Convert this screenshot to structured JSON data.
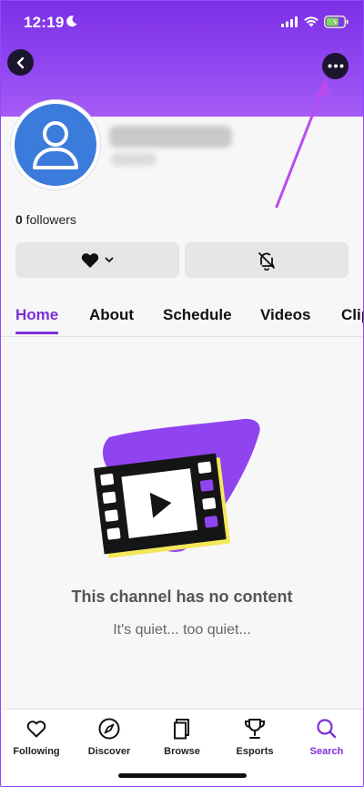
{
  "status_bar": {
    "time": "12:19"
  },
  "profile": {
    "followers_count": "0",
    "followers_label": " followers"
  },
  "tabs": [
    {
      "label": "Home",
      "active": true
    },
    {
      "label": "About",
      "active": false
    },
    {
      "label": "Schedule",
      "active": false
    },
    {
      "label": "Videos",
      "active": false
    },
    {
      "label": "Clips",
      "active": false
    }
  ],
  "empty_state": {
    "title": "This channel has no content",
    "subtitle": "It's quiet... too quiet..."
  },
  "bottom_nav": [
    {
      "label": "Following",
      "icon": "heart-outline-icon",
      "active": false
    },
    {
      "label": "Discover",
      "icon": "compass-icon",
      "active": false
    },
    {
      "label": "Browse",
      "icon": "browse-icon",
      "active": false
    },
    {
      "label": "Esports",
      "icon": "trophy-icon",
      "active": false
    },
    {
      "label": "Search",
      "icon": "search-icon",
      "active": true
    }
  ],
  "colors": {
    "accent": "#7d2fd6",
    "header_gradient_top": "#7c2fe6",
    "header_gradient_bottom": "#a55cf5",
    "avatar_blue": "#3b7bdb",
    "annotation_arrow": "#b84cf0"
  }
}
